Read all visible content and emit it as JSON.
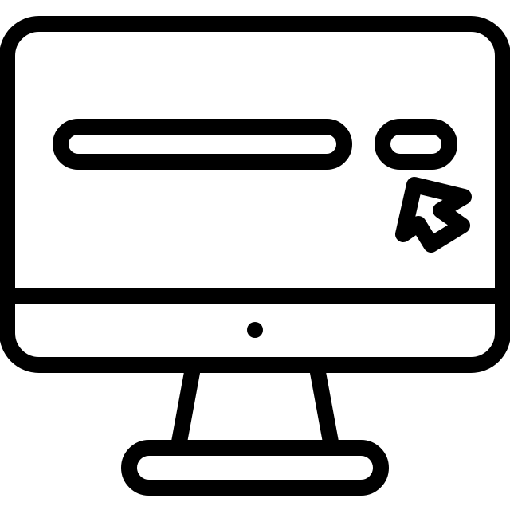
{
  "icon": {
    "name": "monitor-search-icon",
    "stroke_color": "#000000",
    "fill_color": "#ffffff"
  }
}
